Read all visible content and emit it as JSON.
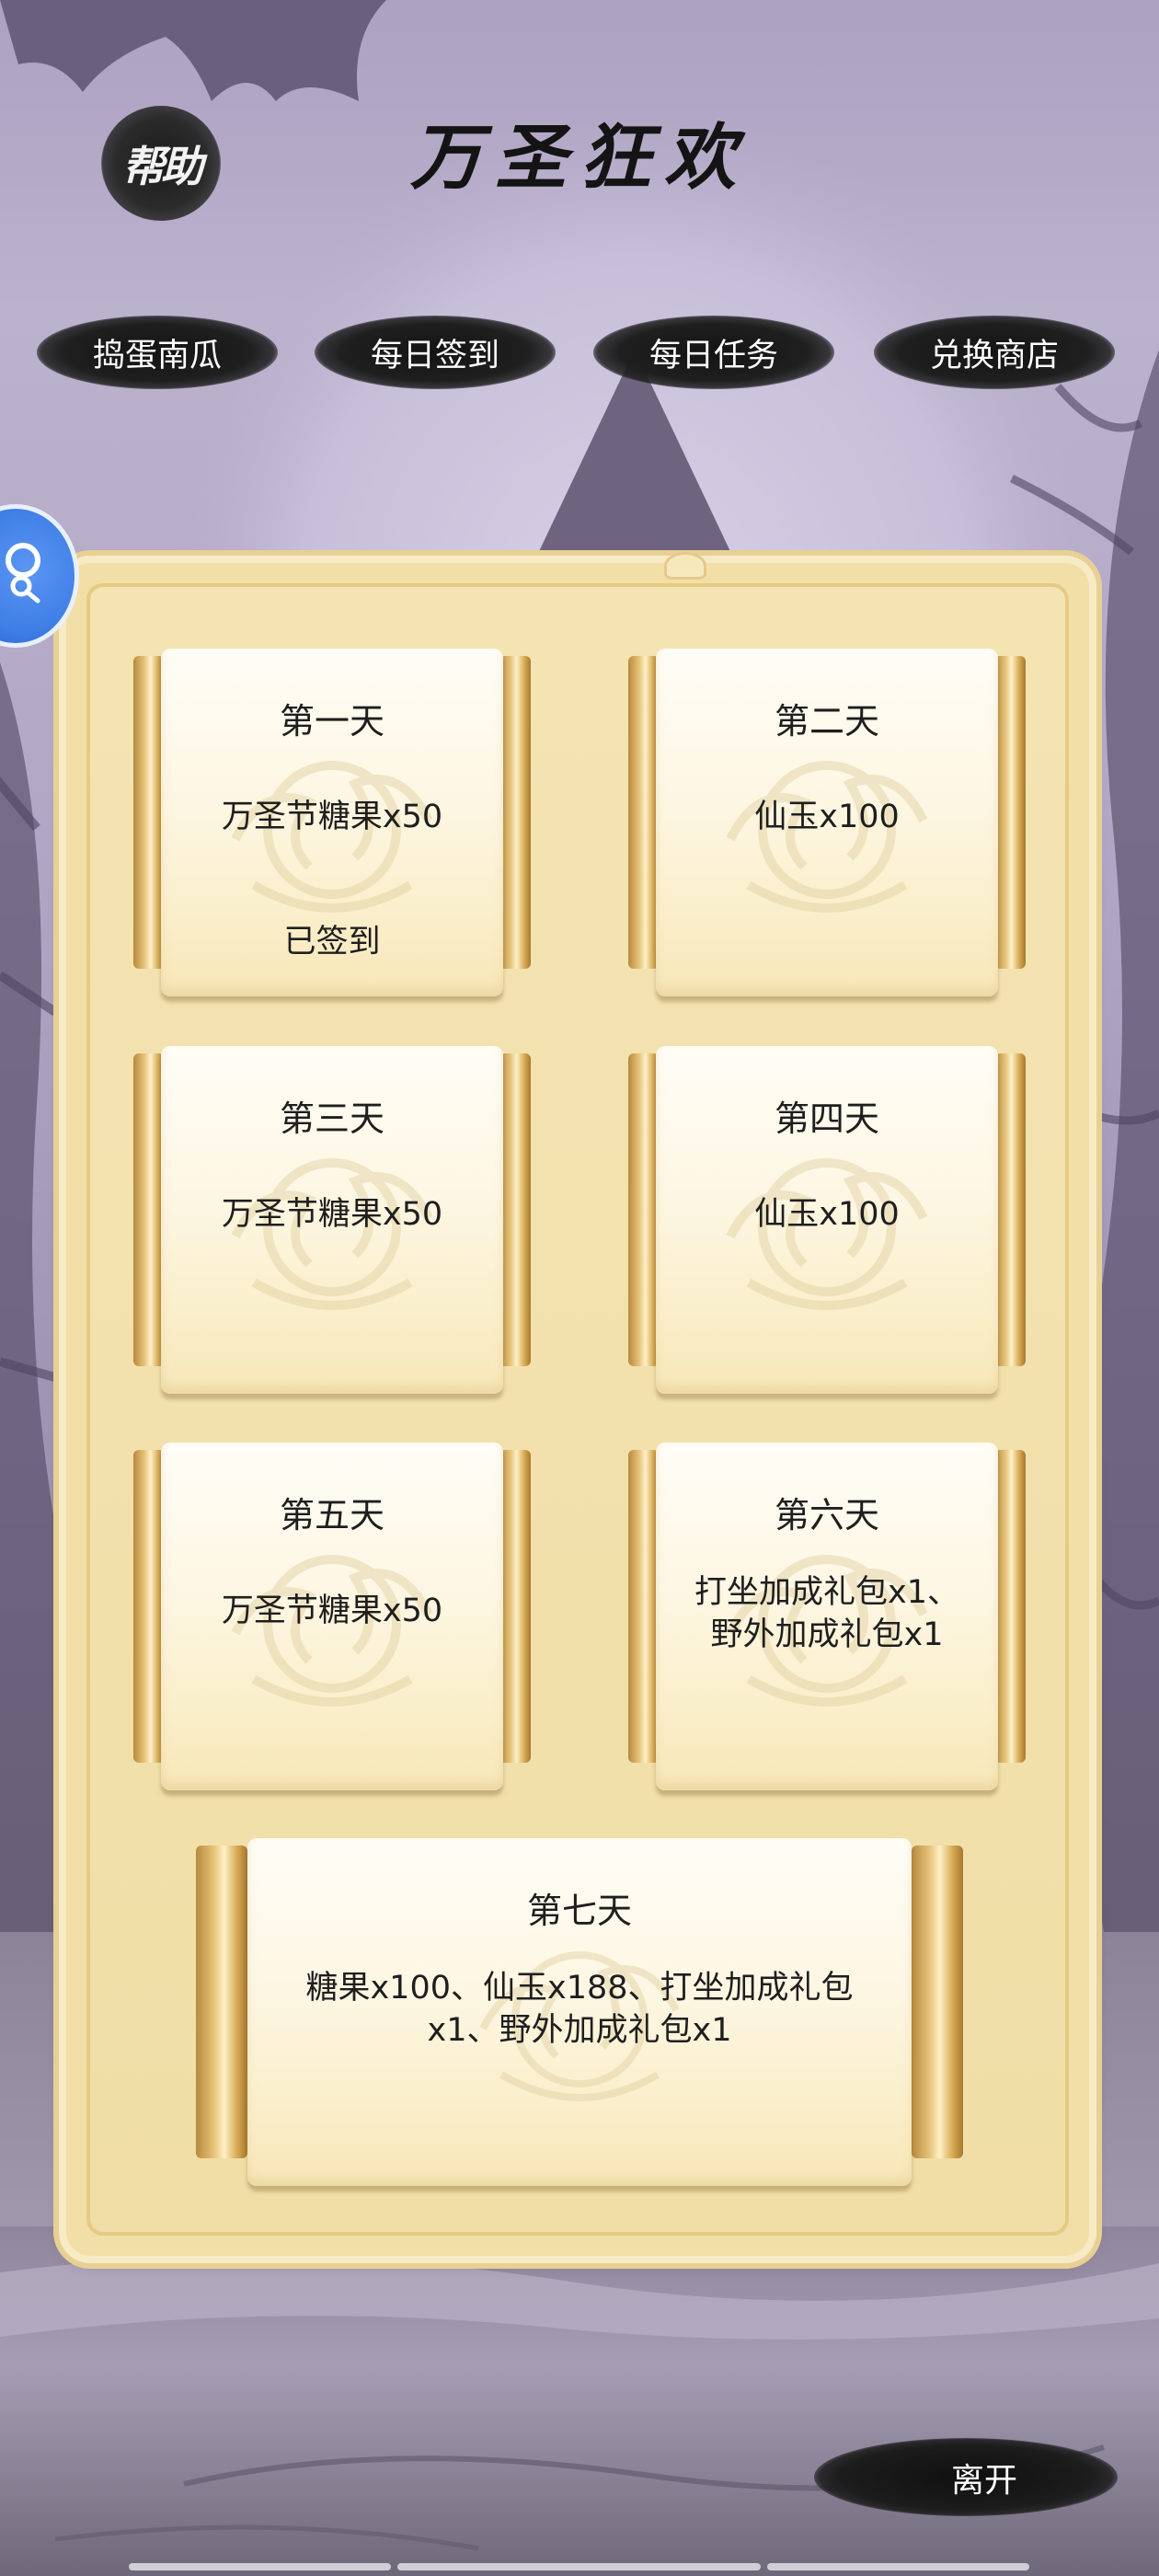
{
  "header": {
    "help_label": "帮助",
    "title": "万圣狂欢"
  },
  "nav": {
    "tabs": [
      {
        "label": "捣蛋南瓜"
      },
      {
        "label": "每日签到"
      },
      {
        "label": "每日任务"
      },
      {
        "label": "兑换商店"
      }
    ]
  },
  "checkin": {
    "days": [
      {
        "day": "第一天",
        "reward": "万圣节糖果x50",
        "status": "已签到"
      },
      {
        "day": "第二天",
        "reward": "仙玉x100",
        "status": ""
      },
      {
        "day": "第三天",
        "reward": "万圣节糖果x50",
        "status": ""
      },
      {
        "day": "第四天",
        "reward": "仙玉x100",
        "status": ""
      },
      {
        "day": "第五天",
        "reward": "万圣节糖果x50",
        "status": ""
      },
      {
        "day": "第六天",
        "reward": "打坐加成礼包x1、野外加成礼包x1",
        "status": ""
      },
      {
        "day": "第七天",
        "reward": "糖果x100、仙玉x188、打坐加成礼包x1、野外加成礼包x1",
        "status": ""
      }
    ]
  },
  "footer": {
    "leave_label": "离开"
  },
  "icons": {
    "side_button": "search-icon"
  },
  "colors": {
    "background": "#b3a9c7",
    "panel": "#f2dfa8",
    "ink": "#141414",
    "accent_blue": "#3f7ee6"
  }
}
